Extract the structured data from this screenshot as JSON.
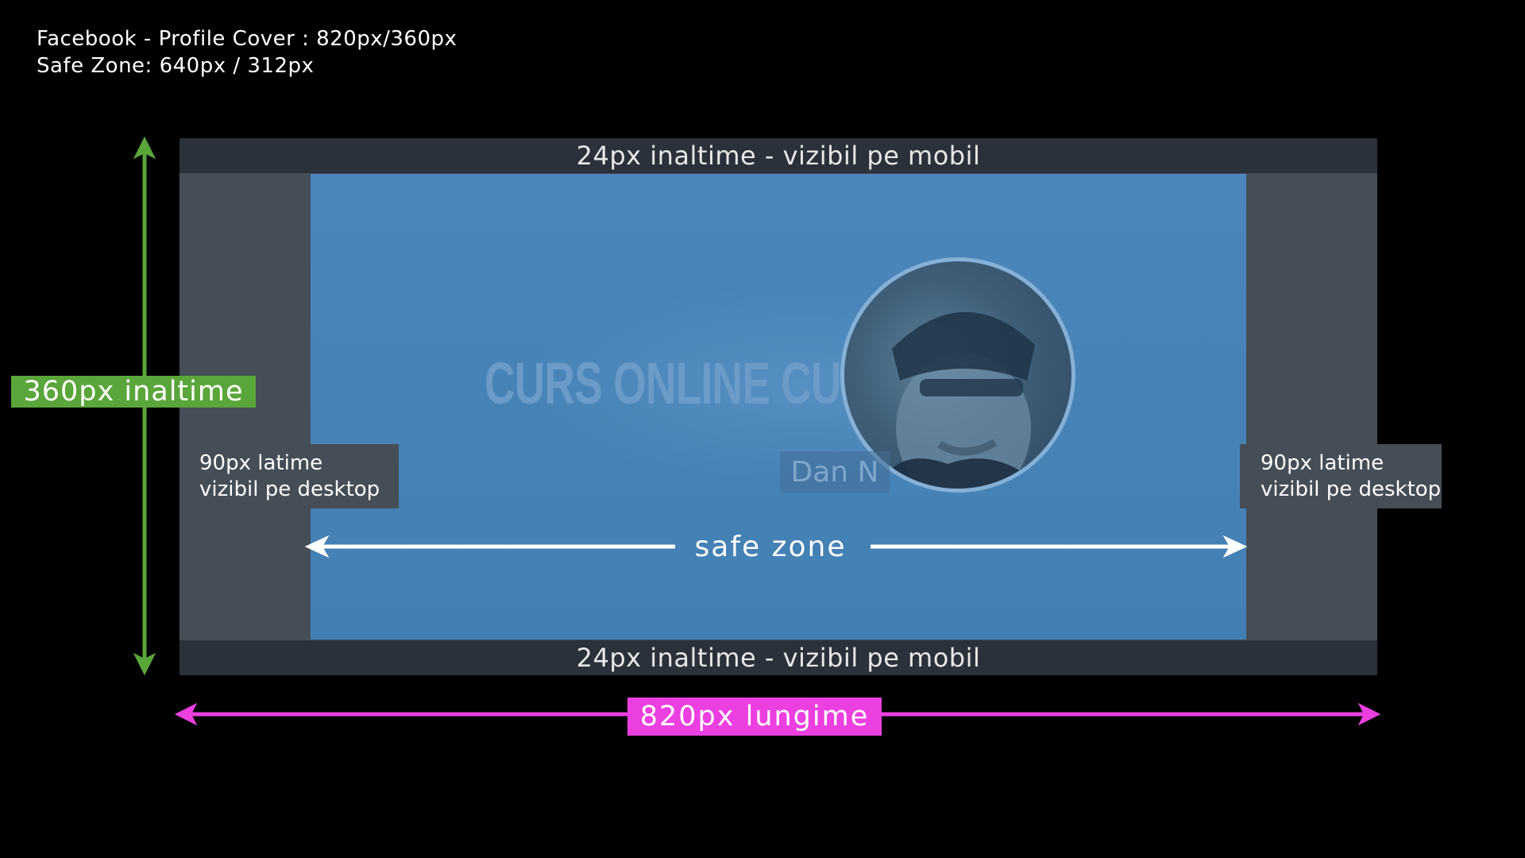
{
  "header": {
    "line1": "Facebook - Profile Cover : 820px/360px",
    "line2": "Safe Zone:  640px / 312px"
  },
  "cover": {
    "top_band_label": "24px inaltime - vizibil pe mobil",
    "bottom_band_label": "24px inaltime - vizibil pe mobil",
    "safe_zone_label": "safe zone",
    "brand_text": "CURS ONLINE CU",
    "name_badge": "Dan N"
  },
  "side_labels": {
    "left": {
      "line1": "90px latime",
      "line2": "vizibil pe desktop"
    },
    "right": {
      "line1": "90px latime",
      "line2": "vizibil pe desktop"
    }
  },
  "dimensions": {
    "height_label": "360px inaltime",
    "width_label": "820px lungime"
  },
  "colors": {
    "background": "#000000",
    "side_panel": "#454e57",
    "mobile_band": "#2a313a",
    "safe_zone": "#4682b6",
    "height_arrow": "#5aa63a",
    "width_arrow": "#ec3fe0",
    "safe_zone_arrow": "#ffffff"
  },
  "icons": {
    "avatar": "profile-photo-icon",
    "height_arrow": "double-arrow-vertical-icon",
    "width_arrow": "double-arrow-horizontal-icon",
    "safe_zone_arrow": "double-arrow-horizontal-icon"
  }
}
